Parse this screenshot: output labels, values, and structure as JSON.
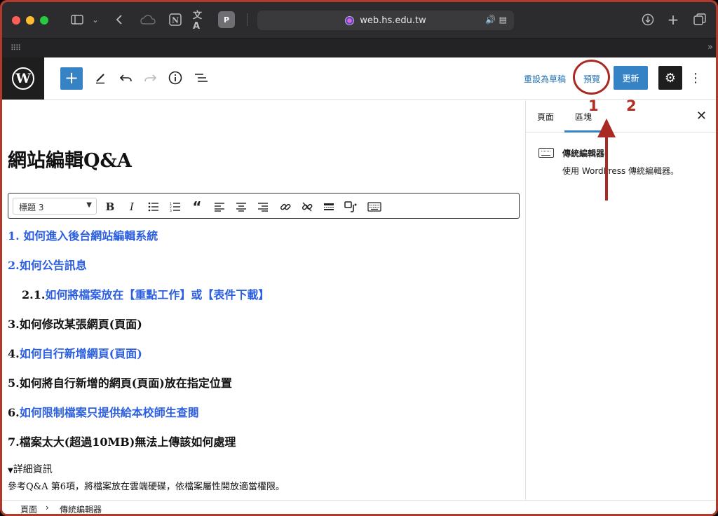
{
  "browser": {
    "url": "web.hs.edu.tw",
    "colors": {
      "close": "#ff5f57",
      "minimize": "#febc2e",
      "zoom": "#28c840"
    },
    "icons": [
      "sidebar-icon",
      "chevron-down-icon",
      "back-icon",
      "cloud-icon",
      "notion-icon",
      "translate-icon",
      "p-extension-icon",
      "download-icon",
      "new-tab-icon",
      "tabs-overview-icon"
    ]
  },
  "toolbar": {
    "save_draft": "重設為草稿",
    "preview": "預覽",
    "update": "更新",
    "accent": "#3582c4"
  },
  "annotations": {
    "label_1": "1",
    "label_2": "2",
    "color": "#b32d23"
  },
  "editor": {
    "title": "網站編輯Q&A",
    "format_select": "標題 3",
    "items": [
      {
        "text": "1. 如何進入後台網站編輯系統",
        "link": true
      },
      {
        "text": "2.如何公告訊息",
        "link": true
      },
      {
        "prefix": "2.1.",
        "text": "如何將檔案放在【重點工作】或【表件下載】",
        "link": true
      },
      {
        "text": "3.如何修改某張網頁(頁面)",
        "link": false
      },
      {
        "prefix": "4.",
        "text": "如何自行新增網頁(頁面)",
        "link": true
      },
      {
        "text": "5.如何將自行新增的網頁(頁面)放在指定位置",
        "link": false
      },
      {
        "prefix": "6.",
        "text": "如何限制檔案只提供給本校師生查閱",
        "link": true
      },
      {
        "text": "7.檔案太大(超過10MB)無法上傳該如何處理",
        "link": false
      }
    ],
    "details_summary": "詳細資訊",
    "details_text": "參考Q&A 第6項，將檔案放在雲端硬碟，依檔案屬性開放適當權限。"
  },
  "sidebar": {
    "tab_page": "頁面",
    "tab_block": "區塊",
    "block_name": "傳統編輯器",
    "block_description": "使用 WordPress 傳統編輯器。"
  },
  "breadcrumb": {
    "root": "頁面",
    "current": "傳統編輯器"
  }
}
